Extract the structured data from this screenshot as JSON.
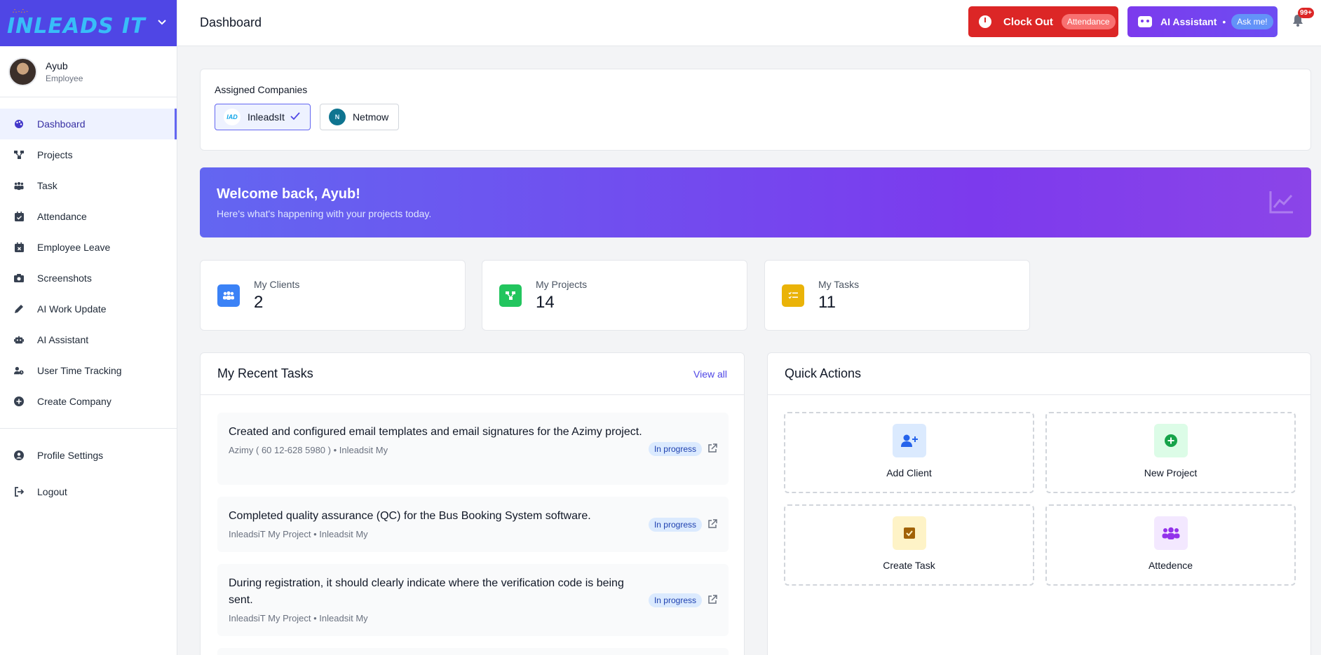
{
  "brand": {
    "logo_text": "INLEADS IT",
    "logo_dots": "∴·∴·"
  },
  "user": {
    "name": "Ayub",
    "role": "Employee"
  },
  "sidebar": {
    "items": [
      {
        "label": "Dashboard",
        "icon": "palette-icon",
        "active": true
      },
      {
        "label": "Projects",
        "icon": "sitemap-icon"
      },
      {
        "label": "Task",
        "icon": "users-icon"
      },
      {
        "label": "Attendance",
        "icon": "calendar-check-icon"
      },
      {
        "label": "Employee Leave",
        "icon": "calendar-x-icon"
      },
      {
        "label": "Screenshots",
        "icon": "camera-icon"
      },
      {
        "label": "AI Work Update",
        "icon": "pencil-icon"
      },
      {
        "label": "AI Assistant",
        "icon": "robot-icon"
      },
      {
        "label": "User Time Tracking",
        "icon": "user-clock-icon"
      },
      {
        "label": "Create Company",
        "icon": "plus-circle-icon"
      }
    ],
    "bottom": [
      {
        "label": "Profile Settings",
        "icon": "user-circle-icon"
      },
      {
        "label": "Logout",
        "icon": "logout-icon"
      }
    ]
  },
  "header": {
    "title": "Dashboard",
    "clock_out_label": "Clock Out",
    "clock_out_pill": "Attendance",
    "ai_label": "AI Assistant",
    "ai_separator": "•",
    "ai_pill": "Ask me!",
    "notification_badge": "99+"
  },
  "companies": {
    "title": "Assigned Companies",
    "list": [
      {
        "name": "InleadsIt",
        "logo_text": "IAD",
        "selected": true
      },
      {
        "name": "Netmow",
        "logo_text": "N",
        "selected": false
      }
    ]
  },
  "welcome": {
    "title": "Welcome back, Ayub!",
    "subtitle": "Here's what's happening with your projects today."
  },
  "stats": [
    {
      "label": "My Clients",
      "value": "2",
      "color": "#3b82f6"
    },
    {
      "label": "My Projects",
      "value": "14",
      "color": "#22c55e"
    },
    {
      "label": "My Tasks",
      "value": "11",
      "color": "#eab308"
    }
  ],
  "recent_tasks": {
    "title": "My Recent Tasks",
    "view_all": "View all",
    "items": [
      {
        "title": "Created and configured email templates and email signatures for the Azimy project.",
        "meta": "Azimy ( 60 12-628 5980 ) • Inleadsit My",
        "status": "In progress"
      },
      {
        "title": "Completed quality assurance (QC) for the Bus Booking System software.",
        "meta": "InleadsiT My Project • Inleadsit My",
        "status": "In progress"
      },
      {
        "title": "During registration, it should clearly indicate where the verification code is being sent.",
        "meta": "InleadsiT My Project • Inleadsit My",
        "status": "In progress"
      }
    ]
  },
  "quick_actions": {
    "title": "Quick Actions",
    "items": [
      {
        "label": "Add Client",
        "icon": "user-plus-icon",
        "bg": "#dbeafe",
        "fg": "#2563eb"
      },
      {
        "label": "New Project",
        "icon": "plus-circle-icon",
        "bg": "#dcfce7",
        "fg": "#16a34a"
      },
      {
        "label": "Create Task",
        "icon": "check-square-icon",
        "bg": "#fef3c7",
        "fg": "#a16207"
      },
      {
        "label": "Attedence",
        "icon": "users-icon",
        "bg": "#f3e8ff",
        "fg": "#9333ea"
      }
    ]
  }
}
